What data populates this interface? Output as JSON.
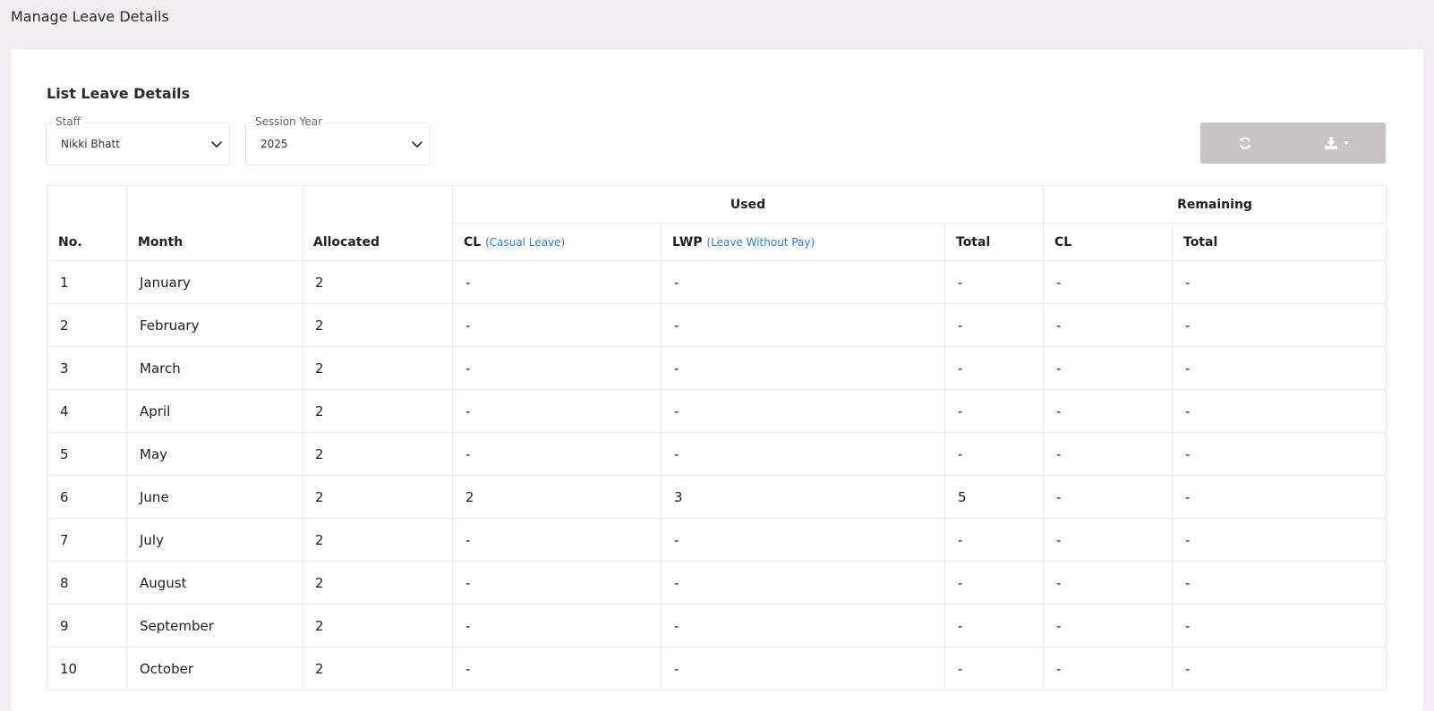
{
  "page_title": "Manage Leave Details",
  "card_title": "List Leave Details",
  "filters": {
    "staff": {
      "label": "Staff",
      "value": "Nikki Bhatt"
    },
    "session_year": {
      "label": "Session Year",
      "value": "2025"
    }
  },
  "toolbar": {
    "refresh_icon": "refresh-icon",
    "export_icon": "download-icon",
    "button_bg": "#c9c3c3"
  },
  "table": {
    "headers": {
      "no": "No.",
      "month": "Month",
      "allocated": "Allocated",
      "used_group": "Used",
      "remaining_group": "Remaining",
      "used_cl": "CL",
      "used_cl_sub": "(Casual Leave)",
      "used_lwp": "LWP",
      "used_lwp_sub": "(Leave Without Pay)",
      "used_total": "Total",
      "remaining_cl": "CL",
      "remaining_total": "Total"
    },
    "rows": [
      [
        "1",
        "January",
        "2",
        "-",
        "-",
        "-",
        "-",
        "-"
      ],
      [
        "2",
        "February",
        "2",
        "-",
        "-",
        "-",
        "-",
        "-"
      ],
      [
        "3",
        "March",
        "2",
        "-",
        "-",
        "-",
        "-",
        "-"
      ],
      [
        "4",
        "April",
        "2",
        "-",
        "-",
        "-",
        "-",
        "-"
      ],
      [
        "5",
        "May",
        "2",
        "-",
        "-",
        "-",
        "-",
        "-"
      ],
      [
        "6",
        "June",
        "2",
        "2",
        "3",
        "5",
        "-",
        "-"
      ],
      [
        "7",
        "July",
        "2",
        "-",
        "-",
        "-",
        "-",
        "-"
      ],
      [
        "8",
        "August",
        "2",
        "-",
        "-",
        "-",
        "-",
        "-"
      ],
      [
        "9",
        "September",
        "2",
        "-",
        "-",
        "-",
        "-",
        "-"
      ],
      [
        "10",
        "October",
        "2",
        "-",
        "-",
        "-",
        "-",
        "-"
      ]
    ]
  },
  "colors": {
    "page_bg": "#f2ecf2",
    "link_blue": "#2b7fc2"
  }
}
